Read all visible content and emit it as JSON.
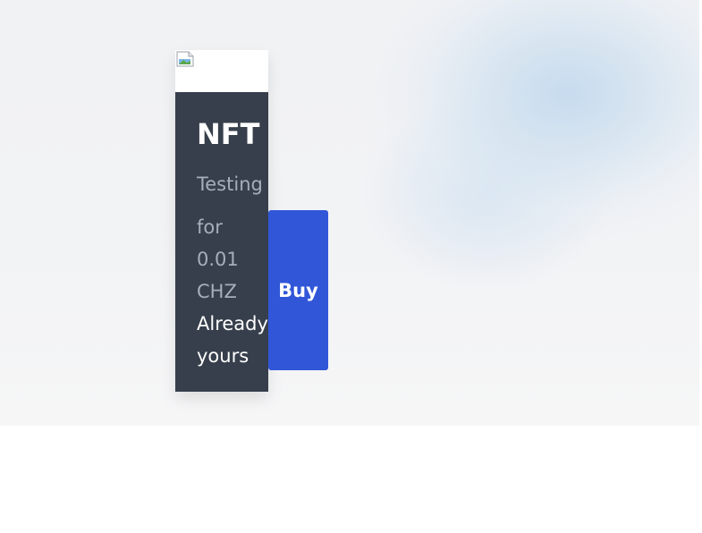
{
  "nft": {
    "image_alt": "nft_img",
    "title": "NFT",
    "description": "Testing",
    "price_lines": [
      "for",
      "0.01",
      "CHZ"
    ],
    "owned_lines": [
      "Already",
      "yours"
    ],
    "buy_label": "Buy"
  },
  "colors": {
    "card_bg": "#363f4b",
    "buy_button": "#3156d8",
    "muted_text": "#a6aeb9"
  }
}
